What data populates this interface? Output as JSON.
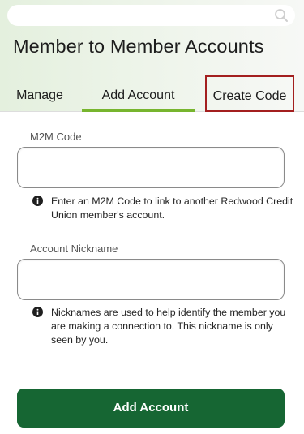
{
  "header": {
    "title": "Member to Member Accounts"
  },
  "search": {
    "icon": "search-icon"
  },
  "tabs": [
    {
      "label": "Manage",
      "active": false
    },
    {
      "label": "Add Account",
      "active": true
    },
    {
      "label": "Create Code",
      "active": false,
      "highlighted": true
    }
  ],
  "form": {
    "code_label": "M2M Code",
    "code_value": "",
    "code_hint": "Enter an M2M Code to link to another Redwood Credit Union member's account.",
    "nickname_label": "Account Nickname",
    "nickname_value": "",
    "nickname_hint": "Nicknames are used to help identify the member you are making a connection to. This nickname is only seen by you.",
    "hint_icon": "info-icon",
    "submit_label": "Add Account"
  },
  "colors": {
    "accent_underline": "#77b52e",
    "highlight_border": "#a31f1f",
    "primary_button": "#166633"
  }
}
